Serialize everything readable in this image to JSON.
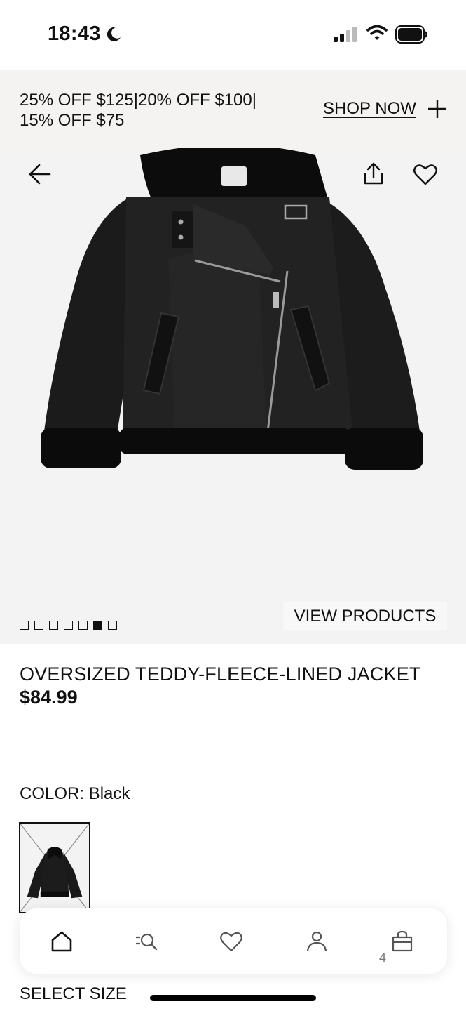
{
  "status_bar": {
    "time": "18:43"
  },
  "promo": {
    "text": "25% OFF $125|20% OFF $100| 15% OFF $75",
    "cta": "SHOP NOW"
  },
  "gallery": {
    "view_products_label": "VIEW PRODUCTS",
    "total_images": 7,
    "active_index": 5
  },
  "product": {
    "title": "OVERSIZED TEDDY-FLEECE-LINED JACKET",
    "price": "$84.99",
    "color_label": "COLOR: Black",
    "select_size_label": "SELECT SIZE"
  },
  "nav": {
    "items": [
      {
        "name": "home",
        "icon": "home-icon"
      },
      {
        "name": "search",
        "icon": "search-icon"
      },
      {
        "name": "favorites",
        "icon": "heart-icon"
      },
      {
        "name": "account",
        "icon": "user-icon"
      },
      {
        "name": "bag",
        "icon": "shopping-bag-icon"
      }
    ],
    "bag_count": "4"
  },
  "colors": {
    "promo_bg": "#f4f3f2",
    "hero_bg": "#f3f3f3",
    "text": "#111111"
  }
}
